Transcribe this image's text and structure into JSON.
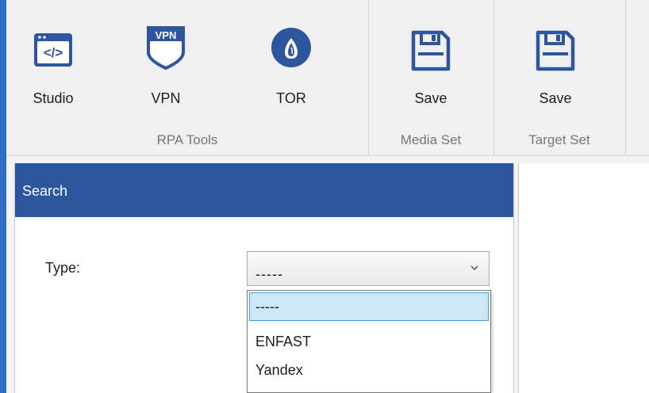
{
  "ribbon": {
    "groups": [
      {
        "label": "RPA Tools",
        "buttons": [
          {
            "label": "Studio",
            "icon": "studio-code-icon"
          },
          {
            "label": "VPN",
            "icon": "vpn-shield-icon"
          },
          {
            "label": "TOR",
            "icon": "tor-onion-icon"
          }
        ]
      },
      {
        "label": "Media Set",
        "buttons": [
          {
            "label": "Save",
            "icon": "floppy-disk-icon"
          }
        ]
      },
      {
        "label": "Target Set",
        "buttons": [
          {
            "label": "Save",
            "icon": "floppy-disk-icon"
          }
        ]
      }
    ],
    "icon_color": "#2d569f"
  },
  "search_panel": {
    "title": "Search",
    "type_label": "Type:",
    "type_select": {
      "value": "-----",
      "options": [
        "-----",
        "ENFAST",
        "Yandex"
      ],
      "selected_index": 0,
      "expanded": true
    }
  },
  "colors": {
    "accent": "#2d569f",
    "window_background": "#2b6cc4",
    "selection": "#cce8f8"
  }
}
